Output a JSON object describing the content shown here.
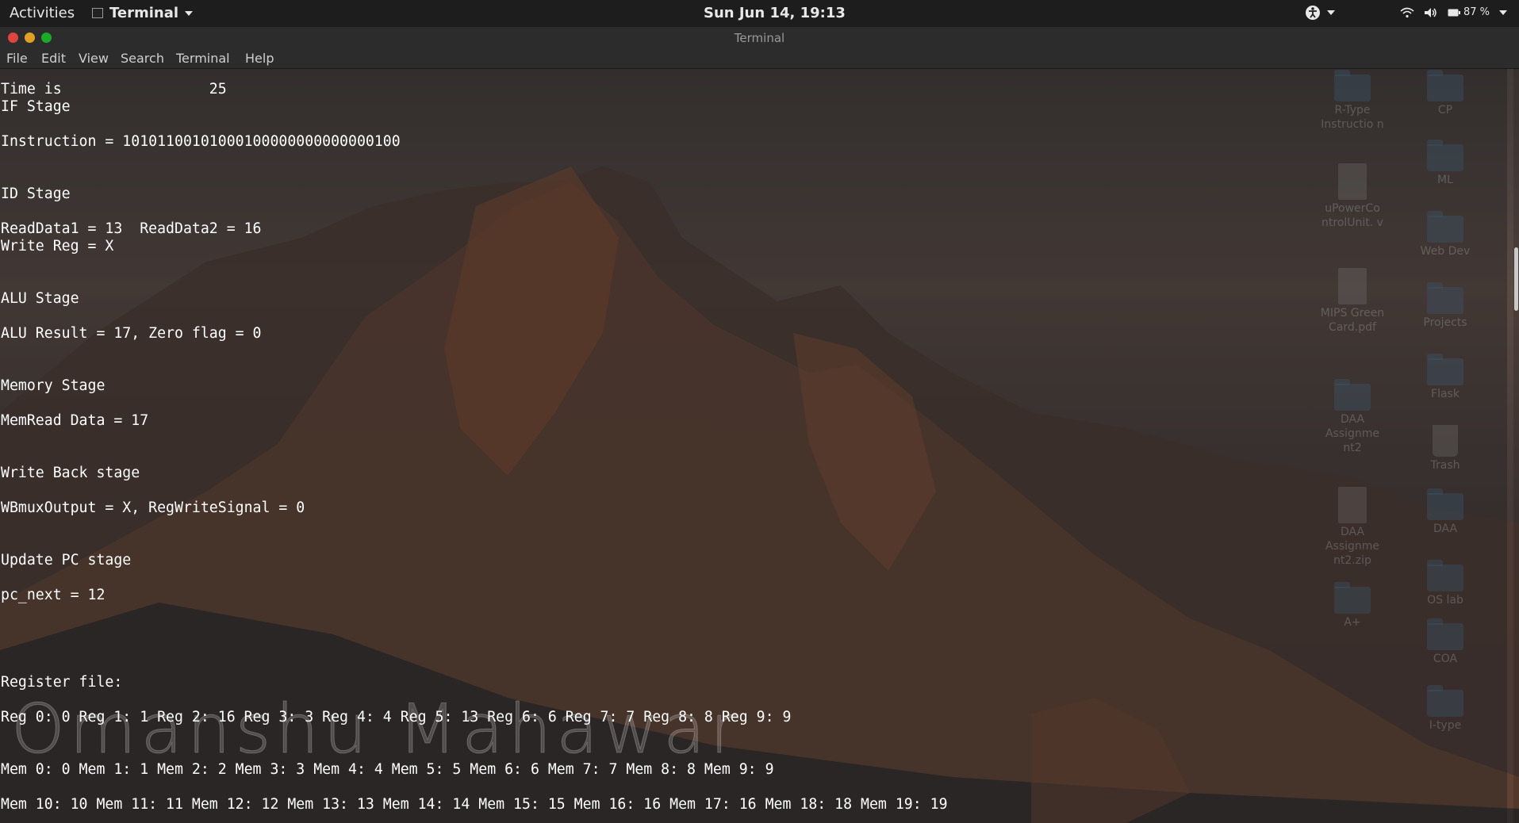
{
  "topbar": {
    "activities": "Activities",
    "app_name": "Terminal",
    "clock": "Sun Jun 14, 19:13",
    "battery": "87 %",
    "icons": [
      "accessibility-icon",
      "wifi-icon",
      "volume-icon",
      "battery-icon"
    ]
  },
  "window": {
    "title": "Terminal",
    "buttons": {
      "close": "#e0443e",
      "minimize": "#dea123",
      "maximize": "#1aab29"
    }
  },
  "menubar": {
    "items": [
      "File",
      "Edit",
      "View",
      "Search",
      "Terminal",
      "Help"
    ]
  },
  "terminal": {
    "lines": [
      "Time is                 25",
      "IF Stage",
      "Instruction = 10101100101000100000000000000100",
      "ID Stage",
      "ReadData1 = 13  ReadData2 = 16",
      "Write Reg = X",
      "ALU Stage",
      "ALU Result = 17, Zero flag = 0",
      "Memory Stage",
      "MemRead Data = 17",
      "Write Back stage",
      "WBmuxOutput = X, RegWriteSignal = 0",
      "Update PC stage",
      "pc_next = 12",
      "Register file:",
      "Reg 0: 0 Reg 1: 1 Reg 2: 16 Reg 3: 3 Reg 4: 4 Reg 5: 13 Reg 6: 6 Reg 7: 7 Reg 8: 8 Reg 9: 9",
      "Mem 0: 0 Mem 1: 1 Mem 2: 2 Mem 3: 3 Mem 4: 4 Mem 5: 5 Mem 6: 6 Mem 7: 7 Mem 8: 8 Mem 9: 9",
      "Mem 10: 10 Mem 11: 11 Mem 12: 12 Mem 13: 13 Mem 14: 14 Mem 15: 15 Mem 16: 16 Mem 17: 16 Mem 18: 18 Mem 19: 19"
    ]
  },
  "watermark": "Omanshu Mahawar",
  "desktop": {
    "icons": [
      {
        "label": "R-Type Instructio n",
        "kind": "folder"
      },
      {
        "label": "CP",
        "kind": "folder"
      },
      {
        "label": "uPowerCo ntrolUnit. v",
        "kind": "file"
      },
      {
        "label": "ML",
        "kind": "folder"
      },
      {
        "label": "Web Dev",
        "kind": "folder"
      },
      {
        "label": "MIPS Green Card.pdf",
        "kind": "file"
      },
      {
        "label": "Projects",
        "kind": "folder"
      },
      {
        "label": "Flask",
        "kind": "folder"
      },
      {
        "label": "DAA Assignme nt2",
        "kind": "folder"
      },
      {
        "label": "Trash",
        "kind": "trash"
      },
      {
        "label": "DAA Assignme nt2.zip",
        "kind": "file"
      },
      {
        "label": "DAA",
        "kind": "folder"
      },
      {
        "label": "OS lab",
        "kind": "folder"
      },
      {
        "label": "A+",
        "kind": "folder"
      },
      {
        "label": "COA",
        "kind": "folder"
      },
      {
        "label": "I-type",
        "kind": "folder"
      }
    ]
  }
}
